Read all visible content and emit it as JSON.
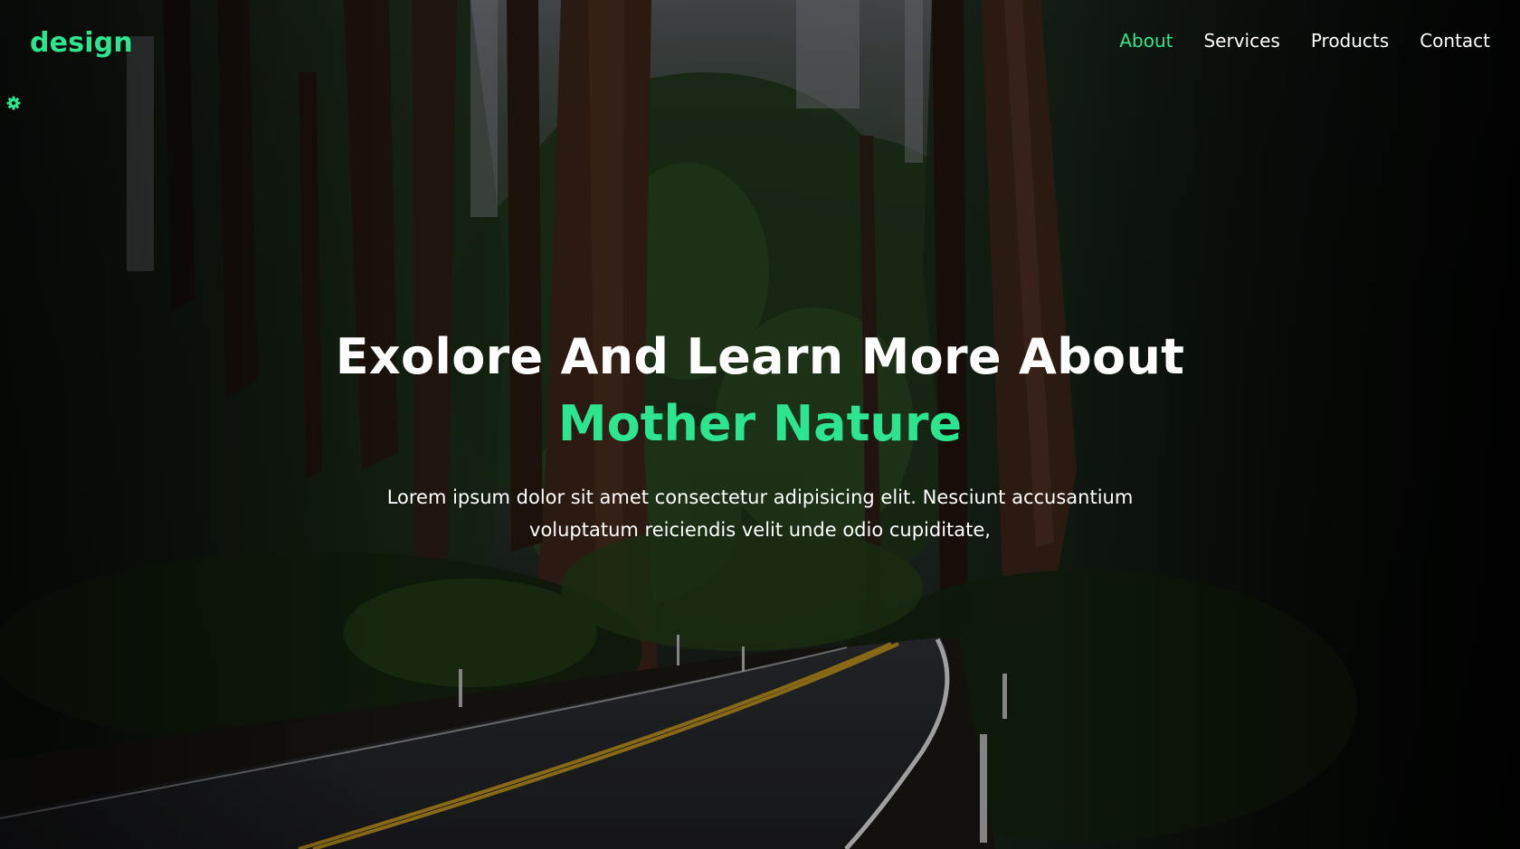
{
  "brand": {
    "logo_text": "design",
    "accent_color": "#2ee58f"
  },
  "settings": {
    "icon": "gear-icon"
  },
  "nav": {
    "items": [
      {
        "label": "About",
        "active": true
      },
      {
        "label": "Services",
        "active": false
      },
      {
        "label": "Products",
        "active": false
      },
      {
        "label": "Contact",
        "active": false
      }
    ]
  },
  "hero": {
    "title_line1": "Exolore And Learn More About",
    "title_line2": "Mother Nature",
    "description": "Lorem ipsum dolor sit amet consectetur adipisicing elit. Nesciunt accusantium voluptatum reiciendis velit unde odio cupiditate,"
  }
}
